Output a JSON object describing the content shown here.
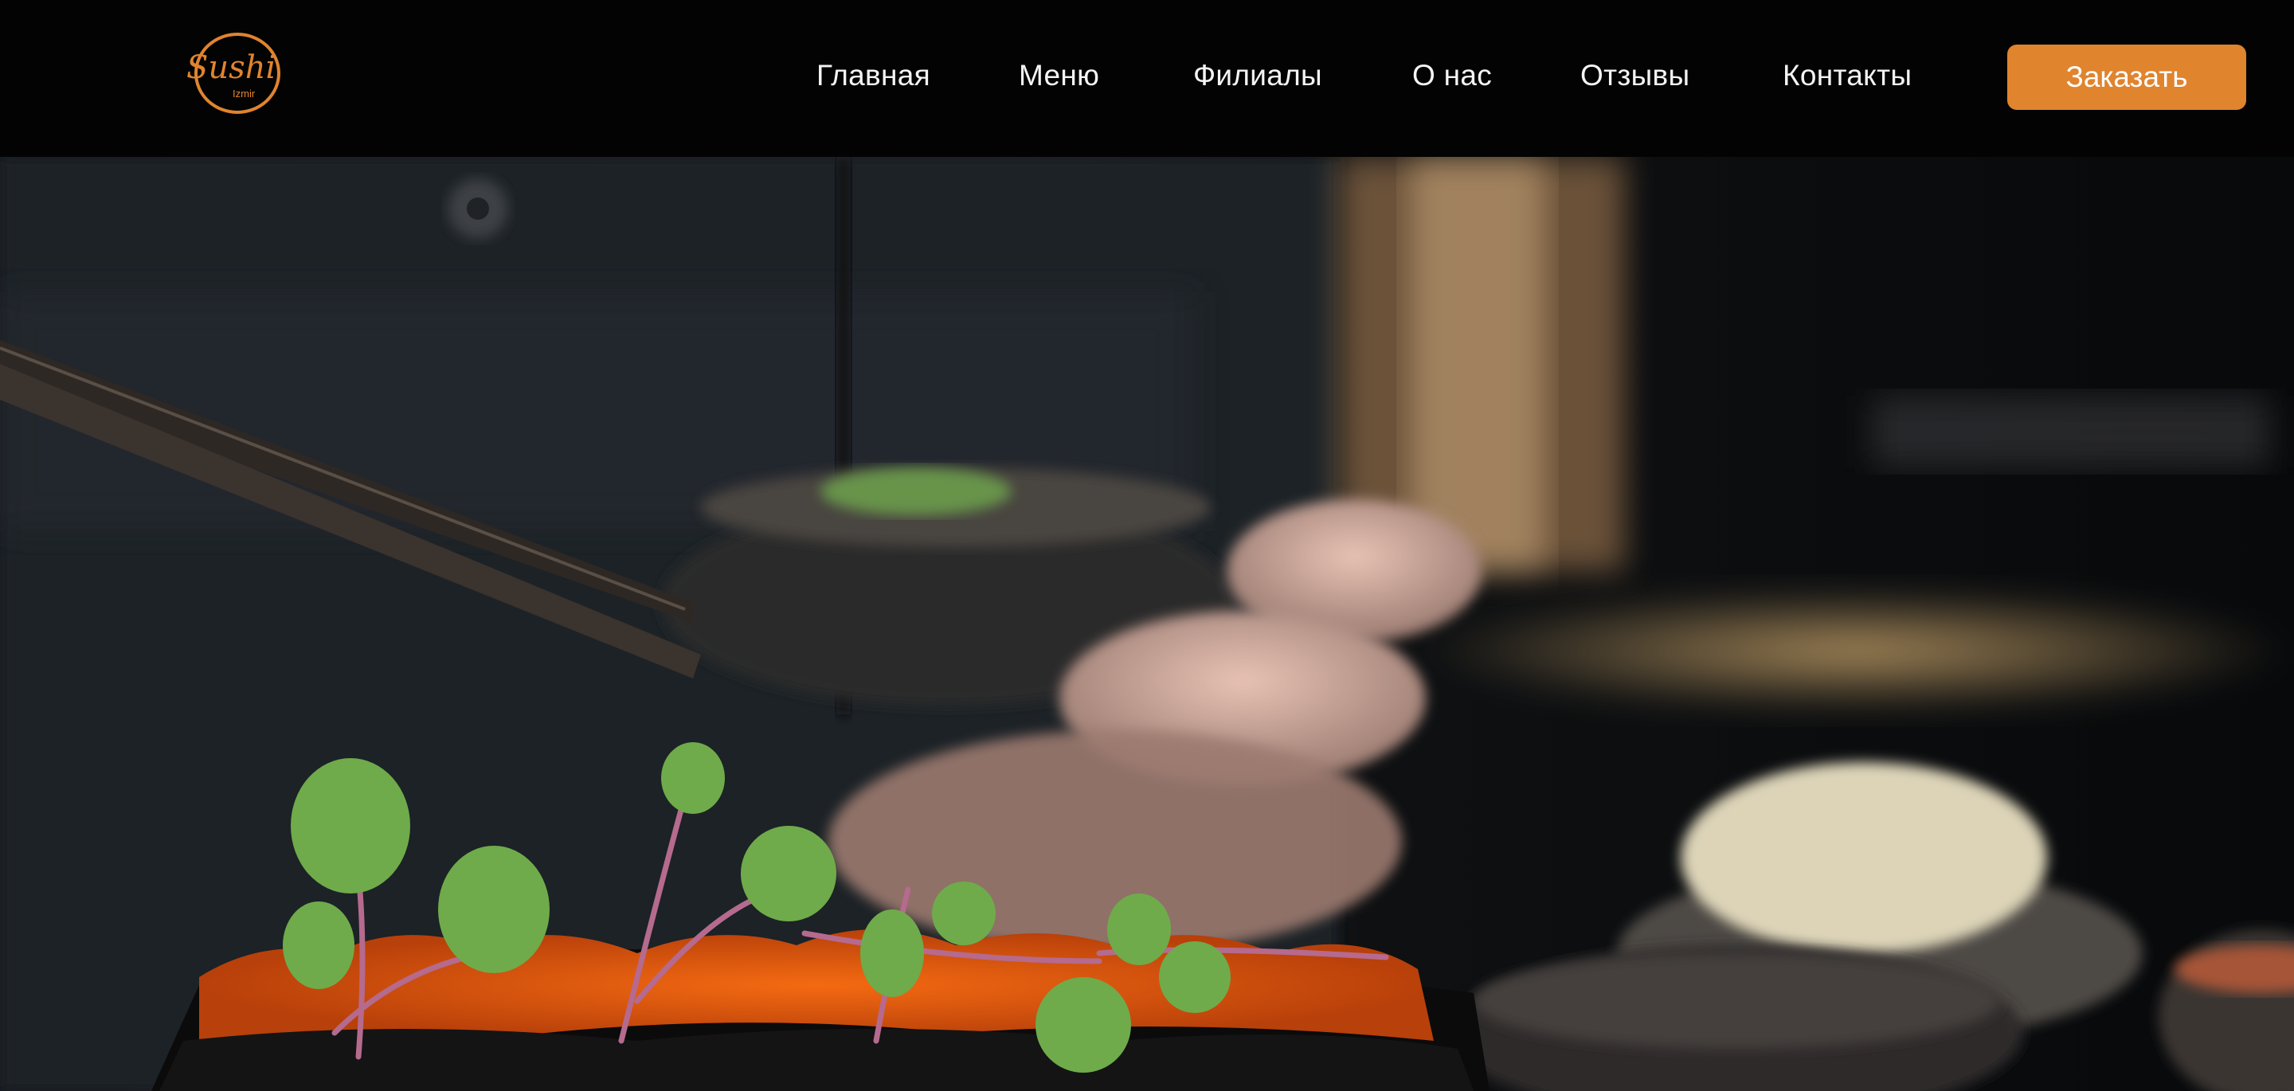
{
  "brand": {
    "logo_script": "Sushi",
    "logo_sub": "Izmir",
    "accent_color": "#e0842e"
  },
  "nav": {
    "items": [
      {
        "label": "Главная"
      },
      {
        "label": "Меню"
      },
      {
        "label": "Филиалы"
      },
      {
        "label": "О нас"
      },
      {
        "label": "Отзывы"
      },
      {
        "label": "Контакты"
      }
    ]
  },
  "cta": {
    "label": "Заказать"
  },
  "hero": {
    "image_subject": "chef-plating-sushi-photo"
  }
}
